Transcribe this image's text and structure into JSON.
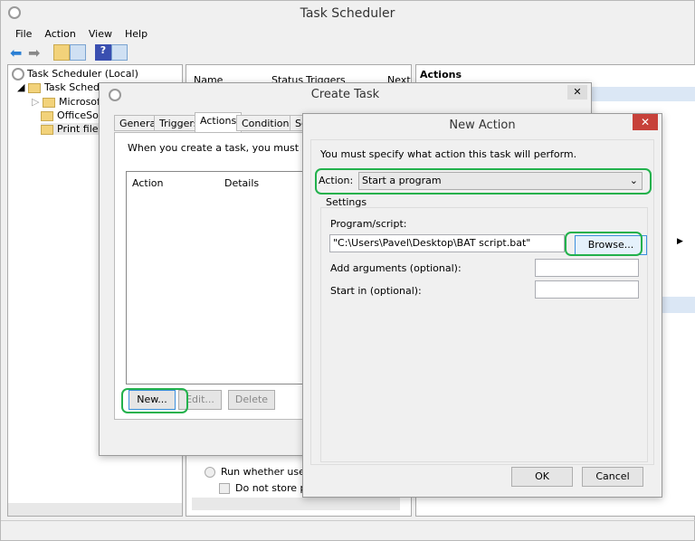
{
  "main": {
    "title": "Task Scheduler",
    "menu": [
      "File",
      "Action",
      "View",
      "Help"
    ],
    "tree": {
      "root": "Task Scheduler (Local)",
      "library": "Task Scheduler Library",
      "children": [
        "Microsoft",
        "OfficeSoftwareProtectionPlatform",
        "Print files"
      ]
    },
    "columns": [
      "Name",
      "Status",
      "Triggers",
      "Next"
    ],
    "actions_header": "Actions",
    "behind": {
      "radio_label": "Run whether user is logged on or not",
      "checkbox_label": "Do not store password"
    }
  },
  "create_task": {
    "title": "Create Task",
    "tabs": [
      "General",
      "Triggers",
      "Actions",
      "Conditions",
      "Settings"
    ],
    "active_tab": "Actions",
    "intro": "When you create a task, you must specify the action that will occur when your task starts.",
    "columns": [
      "Action",
      "Details"
    ],
    "buttons": {
      "new": "New...",
      "edit": "Edit...",
      "delete": "Delete"
    }
  },
  "new_action": {
    "title": "New Action",
    "close": "✕",
    "intro": "You must specify what action this task will perform.",
    "action_label": "Action:",
    "action_value": "Start a program",
    "settings_label": "Settings",
    "program_label": "Program/script:",
    "program_value": "\"C:\\Users\\Pavel\\Desktop\\BAT script.bat\"",
    "browse": "Browse...",
    "args_label": "Add arguments (optional):",
    "args_value": "",
    "start_label": "Start in (optional):",
    "start_value": "",
    "ok": "OK",
    "cancel": "Cancel"
  },
  "colors": {
    "highlight": "#22b14c",
    "close": "#c7413a",
    "actions_bar": "#dbe7f5"
  }
}
